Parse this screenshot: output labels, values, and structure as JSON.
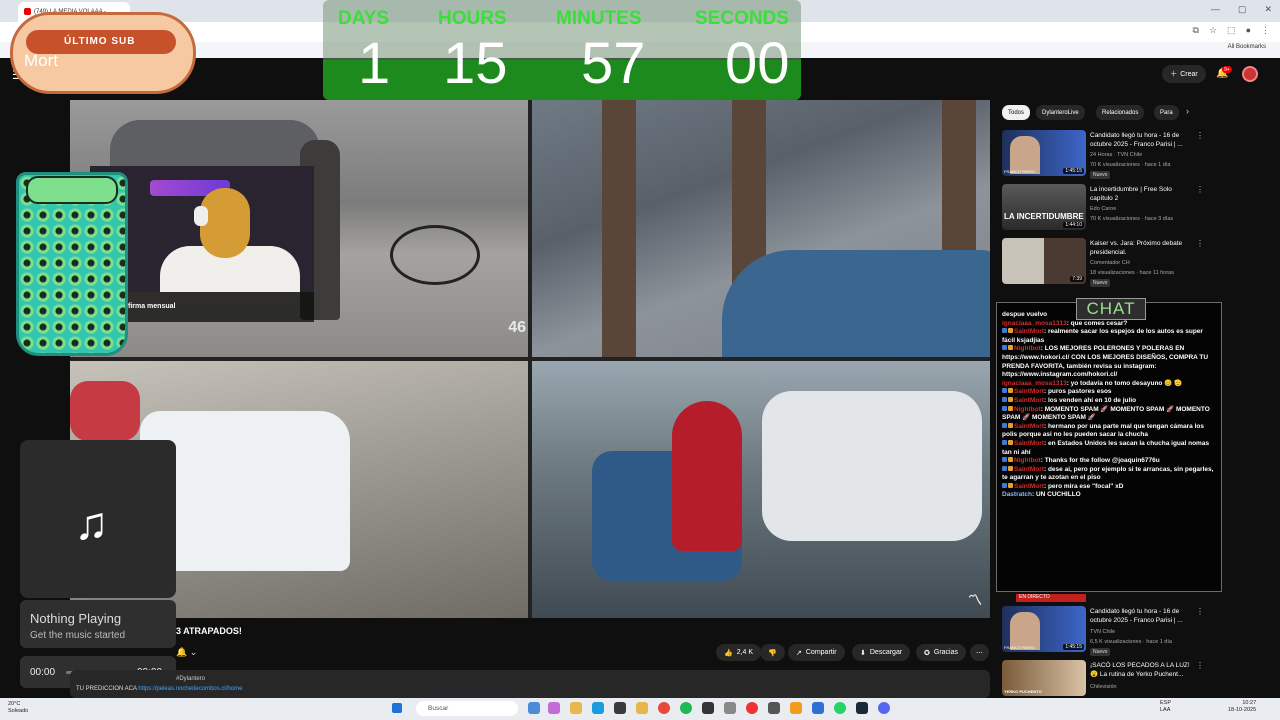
{
  "browser": {
    "tab_title": "(749) LA MEDIA VOLAAA - ...",
    "bookmarks_label": "All Bookmarks",
    "window_controls": [
      "—",
      "▢",
      "✕"
    ]
  },
  "youtube": {
    "create_label": "Crear",
    "notif_count": "9+",
    "chips": [
      "Todos",
      "DylanteroLive",
      "Relacionados",
      "Para"
    ],
    "video_title": "3 ATRAPADOS!",
    "channel_name": "DylanteroLive",
    "actions": {
      "likes": "2,4 K",
      "share": "Compartir",
      "download": "Descargar",
      "thanks": "Gracias"
    },
    "desc_line1": "#Dylantero",
    "desc_line2_prefix": "TU PREDICCION ACA",
    "desc_line2_link": "https://peleas.nochedecombos.cl/home"
  },
  "overlays": {
    "hotdog_label": "ÚLTIMO SUB",
    "hotdog_name": "Mort",
    "sub_text": "firma mensual",
    "cam_number": "46"
  },
  "countdown": {
    "labels": [
      "DAYS",
      "HOURS",
      "MINUTES",
      "SECONDS"
    ],
    "values": [
      "1",
      "15",
      "57",
      "00"
    ],
    "label_color": "#38e038"
  },
  "music": {
    "status": "Nothing Playing",
    "subtitle": "Get the music started",
    "time_current": "00:00",
    "time_total": "00:00"
  },
  "recommendations": [
    {
      "title": "Candidato llegó tu hora - 16 de octubre 2025 - Franco Parisi | ...",
      "channel": "24 Horas · TVN Chile",
      "meta": "70 K visualizaciones · hace 1 día",
      "badge": "Nuevo",
      "duration": "1:45:15",
      "thumb_text": "FRANCO PARISI"
    },
    {
      "title": "La incertidumbre | Free Solo capítulo 2",
      "channel": "Edo Caroe",
      "meta": "70 K visualizaciones · hace 3 días",
      "badge": "",
      "duration": "1:44:10",
      "thumb_text": "LA INCERTIDUMBRE"
    },
    {
      "title": "Kaiser vs. Jara: Próximo debate presidencial.",
      "channel": "Comentador CH",
      "meta": "18 visualizaciones · hace 11 horas",
      "badge": "Nuevo",
      "duration": "7:39",
      "thumb_text": ""
    },
    {
      "title": "Candidato llegó tu hora - 16 de octubre 2025 - Franco Parisi | ...",
      "channel": "TVN Chile",
      "meta": "6,5 K visualizaciones · hace 1 día",
      "badge": "Nuevo",
      "duration": "1:45:15",
      "thumb_text": "FRANCO PARISI"
    },
    {
      "title": "¡SACÓ LOS PECADOS A LA LUZ! 😮 La rutina de Yerko Puchent...",
      "channel": "Chilevisión",
      "meta": "",
      "badge": "",
      "duration": "",
      "thumb_text": "YERKO PUCHENTO"
    }
  ],
  "chat": {
    "header": "CHAT",
    "lines": [
      {
        "user": "",
        "text": "despue vuelvo"
      },
      {
        "user": "ignaciaaa_mosa1313",
        "text": ": que comes cesar?"
      },
      {
        "user": "SaintMort",
        "text": ": realmente sacar los espejos de los autos es super fácil ksjadjias"
      },
      {
        "user": "Nightbot",
        "text": ": LOS MEJORES POLERONES Y POLERAS EN https://www.hokori.cl/ CON LOS MEJORES DISEÑOS, COMPRA TU PRENDA FAVORITA, también revisa su instagram: https://www.instagram.com/hokori.cl/"
      },
      {
        "user": "ignaciaaa_mosa1313",
        "text": ": yo todavía no tomo desayuno 😊 🫡"
      },
      {
        "user": "SaintMort",
        "text": ": puros pastores esos"
      },
      {
        "user": "SaintMort",
        "text": ": los venden ahí en 10 de julio"
      },
      {
        "user": "Nightbot",
        "text": ": MOMENTO SPAM 🚀 MOMENTO SPAM 🚀 MOMENTO SPAM 🚀 MOMENTO SPAM 🚀"
      },
      {
        "user": "SaintMort",
        "text": ": hermano por una parte mal que tengan cámara los polis porque asi no les pueden sacar la chucha"
      },
      {
        "user": "SaintMort",
        "text": ": en Estados Unidos les sacan la chucha igual nomas tan ni ahí"
      },
      {
        "user": "Nightbot",
        "text": ": Thanks for the follow @joaquin6776u"
      },
      {
        "user": "SaintMort",
        "text": ": dese ai, pero por ejemplo si te arrancas, sin pegarles, te agarran y te azotan en el piso"
      },
      {
        "user": "SaintMort",
        "text": ": pero mira ese \"focal\" xD"
      },
      {
        "user": "Dastratch",
        "text": ": UN CUCHILLO"
      }
    ],
    "banner": "EN DIRECTO"
  },
  "taskbar": {
    "weather_temp": "20°C",
    "weather_desc": "Soleado",
    "search_placeholder": "Buscar",
    "lang": "ESP",
    "lang_sub": "LAA",
    "time": "10:27",
    "date": "18-10-2025"
  }
}
